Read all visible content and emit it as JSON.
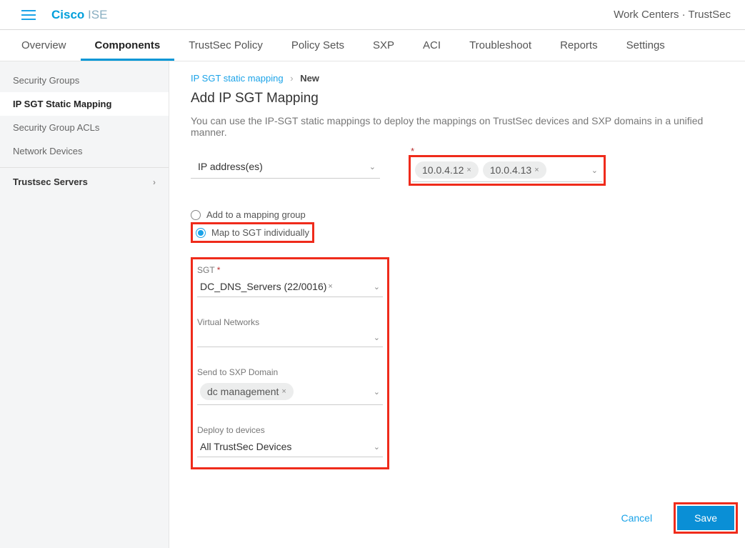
{
  "header": {
    "logo_a": "Cisco",
    "logo_b": "ISE",
    "breadcrumb": "Work Centers · TrustSec"
  },
  "tabs": [
    {
      "label": "Overview"
    },
    {
      "label": "Components"
    },
    {
      "label": "TrustSec Policy"
    },
    {
      "label": "Policy Sets"
    },
    {
      "label": "SXP"
    },
    {
      "label": "ACI"
    },
    {
      "label": "Troubleshoot"
    },
    {
      "label": "Reports"
    },
    {
      "label": "Settings"
    }
  ],
  "sidebar": {
    "items": [
      {
        "label": "Security Groups"
      },
      {
        "label": "IP SGT Static Mapping"
      },
      {
        "label": "Security Group ACLs"
      },
      {
        "label": "Network Devices"
      }
    ],
    "section": "Trustsec Servers"
  },
  "breadcrumb": {
    "link": "IP SGT static mapping",
    "current": "New"
  },
  "page": {
    "title": "Add IP SGT Mapping",
    "desc": "You can use the IP-SGT static mappings to deploy the mappings on TrustSec devices and SXP domains in a unified manner."
  },
  "type_field": "IP address(es)",
  "ip_tags": [
    "10.0.4.12",
    "10.0.4.13"
  ],
  "radio": {
    "opt1": "Add to a mapping group",
    "opt2": "Map to SGT individually"
  },
  "form": {
    "sgt_label": "SGT",
    "sgt_value": "DC_DNS_Servers (22/0016)",
    "vn_label": "Virtual Networks",
    "sxp_label": "Send to SXP Domain",
    "sxp_value": "dc management",
    "deploy_label": "Deploy to devices",
    "deploy_value": "All TrustSec Devices"
  },
  "actions": {
    "cancel": "Cancel",
    "save": "Save"
  }
}
